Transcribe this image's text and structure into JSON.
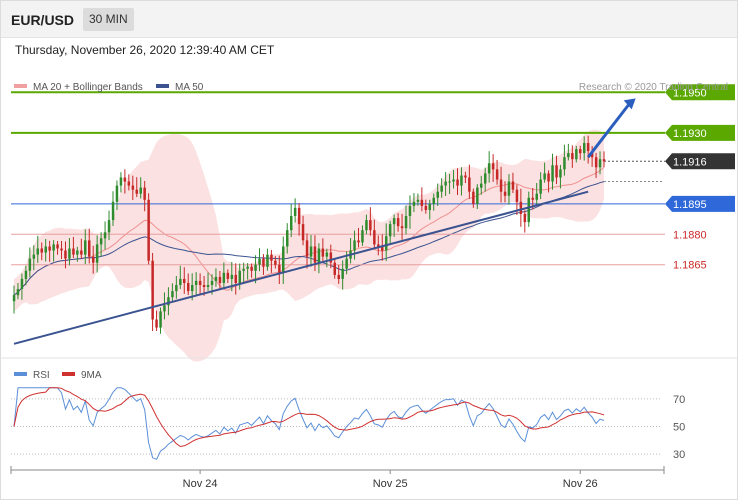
{
  "header": {
    "symbol": "EUR/USD",
    "timeframe": "30 MIN"
  },
  "datetime": "Thursday, November 26, 2020 12:39:40 AM CET",
  "colors": {
    "green": "#5aa800",
    "blue": "#2f68d9",
    "red": "#cc2a2a",
    "dark": "#333333",
    "bollinger": "#f5b5b5",
    "ma50": "#3b5390",
    "rsi": "#5b8fd8",
    "rsi_ma": "#d03030"
  },
  "chart_data": [
    {
      "type": "candlestick",
      "legend": [
        {
          "name": "MA 20 + Bollinger Bands",
          "color": "#f0a0a0"
        },
        {
          "name": "MA 50",
          "color": "#3b5390"
        }
      ],
      "watermark": "Research © 2020 Trading Central",
      "price_range": [
        1.182,
        1.196
      ],
      "levels": [
        {
          "value": 1.195,
          "label": "1.1950",
          "style": "target",
          "color": "#5aa800"
        },
        {
          "value": 1.193,
          "label": "1.1930",
          "style": "resistance",
          "color": "#5aa800"
        },
        {
          "value": 1.1916,
          "label": "1.1916",
          "style": "last-price",
          "color": "#333333"
        },
        {
          "value": 1.1895,
          "label": "1.1895",
          "style": "pivot",
          "color": "#2f68d9"
        },
        {
          "value": 1.188,
          "label": "1.1880",
          "style": "support",
          "color": "#cc2a2a"
        },
        {
          "value": 1.1865,
          "label": "1.1865",
          "style": "support",
          "color": "#cc2a2a"
        }
      ],
      "trendline": {
        "start": [
          0.0,
          1.1826
        ],
        "end": [
          145.0,
          1.1901
        ]
      },
      "arrow": {
        "start": [
          145.0,
          1.1918
        ],
        "end": [
          157.0,
          1.1947
        ]
      },
      "close_series": [
        1.185,
        1.1853,
        1.1858,
        1.1862,
        1.1868,
        1.187,
        1.1873,
        1.1871,
        1.1874,
        1.1872,
        1.1875,
        1.1873,
        1.1872,
        1.1868,
        1.1873,
        1.187,
        1.1872,
        1.187,
        1.1877,
        1.1869,
        1.1866,
        1.1875,
        1.1878,
        1.1881,
        1.1887,
        1.1896,
        1.1904,
        1.1908,
        1.1906,
        1.1904,
        1.1902,
        1.19,
        1.1903,
        1.1897,
        1.1867,
        1.1838,
        1.1834,
        1.1842,
        1.1845,
        1.1849,
        1.1852,
        1.1855,
        1.1858,
        1.1856,
        1.1852,
        1.1855,
        1.1857,
        1.1855,
        1.1854,
        1.1855,
        1.1857,
        1.1859,
        1.1856,
        1.1861,
        1.1858,
        1.186,
        1.1856,
        1.1862,
        1.1863,
        1.1864,
        1.1862,
        1.1865,
        1.1868,
        1.1864,
        1.187,
        1.1867,
        1.1865,
        1.1861,
        1.1874,
        1.1882,
        1.1889,
        1.1893,
        1.1885,
        1.1877,
        1.1869,
        1.1874,
        1.1866,
        1.1873,
        1.1869,
        1.1871,
        1.1866,
        1.186,
        1.1858,
        1.1863,
        1.1868,
        1.1872,
        1.1877,
        1.1876,
        1.1882,
        1.1887,
        1.1882,
        1.1875,
        1.1874,
        1.1872,
        1.1879,
        1.1885,
        1.1888,
        1.1884,
        1.1883,
        1.1889,
        1.1894,
        1.1896,
        1.1897,
        1.1894,
        1.1892,
        1.1895,
        1.1898,
        1.1901,
        1.1904,
        1.1906,
        1.1906,
        1.1907,
        1.1904,
        1.1909,
        1.1908,
        1.1901,
        1.1895,
        1.1903,
        1.1905,
        1.191,
        1.1915,
        1.1912,
        1.1907,
        1.1901,
        1.1899,
        1.1906,
        1.1902,
        1.1896,
        1.189,
        1.1886,
        1.1898,
        1.1897,
        1.19,
        1.1907,
        1.191,
        1.1906,
        1.1914,
        1.1908,
        1.1912,
        1.1918,
        1.192,
        1.1917,
        1.1922,
        1.192,
        1.1925,
        1.1921,
        1.1918,
        1.1913,
        1.1917,
        1.1916
      ],
      "x_ticks": [
        {
          "index": 47,
          "label": "Nov 24"
        },
        {
          "index": 95,
          "label": "Nov 25"
        },
        {
          "index": 143,
          "label": "Nov 26"
        }
      ]
    },
    {
      "type": "line",
      "legend": [
        {
          "name": "RSI",
          "color": "#5b8fd8"
        },
        {
          "name": "9MA",
          "color": "#d03030"
        }
      ],
      "ylim": [
        20,
        80
      ],
      "y_ticks": [
        70,
        50,
        30
      ]
    }
  ]
}
